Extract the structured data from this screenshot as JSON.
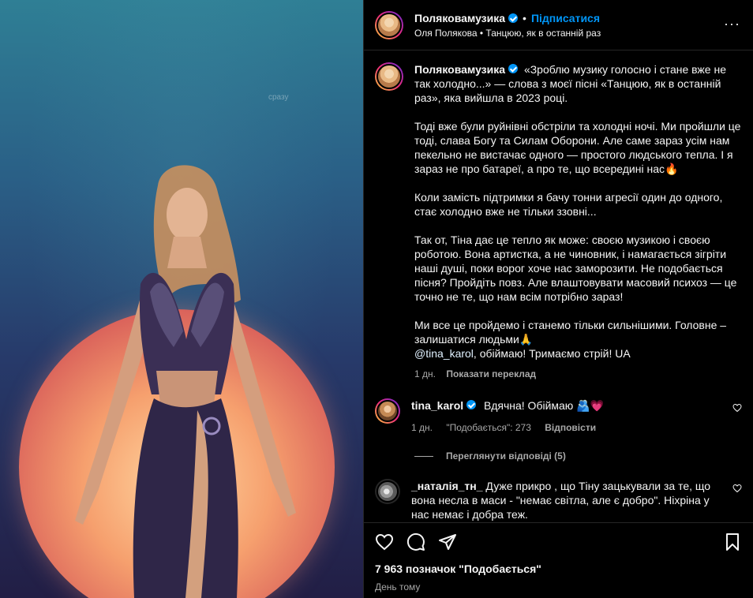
{
  "media": {
    "watermark": "сразу"
  },
  "header": {
    "username": "Поляковамузика",
    "separator": "•",
    "follow_label": "Підписатися",
    "subtitle": "Оля Полякова • Танцюю, як в останній раз",
    "more_label": "···"
  },
  "caption": {
    "username": "Поляковамузика",
    "p1": "«Зроблю музику голосно і стане вже не так холодно...» — слова з моєї пісні «Танцюю, як в останній раз», яка вийшла в 2023 році.",
    "p2": "Тоді вже були руйнівні обстріли та холодні ночі. Ми пройшли це тоді, слава Богу та Силам Оборони. Але саме зараз усім нам пекельно не вистачає одного — простого людського тепла. І я зараз не про батареї, а про те, що всередині нас🔥",
    "p3": "Коли замість підтримки я бачу тонни агресії один до одного, стає холодно вже не тільки ззовні...",
    "p4": "Так от, Тіна дає це тепло як може: своєю музикою і своєю роботою. Вона артистка, а не чиновник, і намагається зігріти наші душі, поки ворог хоче нас заморозити. Не подобається пісня? Пройдіть повз. Але влаштовувати масовий психоз — це точно не те, що нам всім потрібно зараз!",
    "p5": "Ми все це пройдемо і станемо тільки сильнішими. Головне – залишатися людьми🙏",
    "mention": "@tina_karol",
    "p6": ", обіймаю! Тримаємо стрій! UA",
    "age": "1 дн.",
    "translate": "Показати переклад"
  },
  "comments": [
    {
      "username": "tina_karol",
      "text": "Вдячна! Обіймаю 🫂💗",
      "age": "1 дн.",
      "likes": "\"Подобається\": 273",
      "reply": "Відповісти",
      "view_replies": "Переглянути відповіді (5)"
    },
    {
      "username": "_наталія_тн_",
      "text": "Дуже прикро , що Тіну зацькували за те, що вона несла в маси - \"немає світла, але є добро\". Ніхріна у нас немає і добра теж."
    }
  ],
  "footer": {
    "likes": "7 963 позначок \"Подобається\"",
    "when": "День тому"
  },
  "icons": [
    "heart-icon",
    "comment-icon",
    "share-icon",
    "bookmark-icon",
    "more-icon",
    "verified-icon"
  ]
}
